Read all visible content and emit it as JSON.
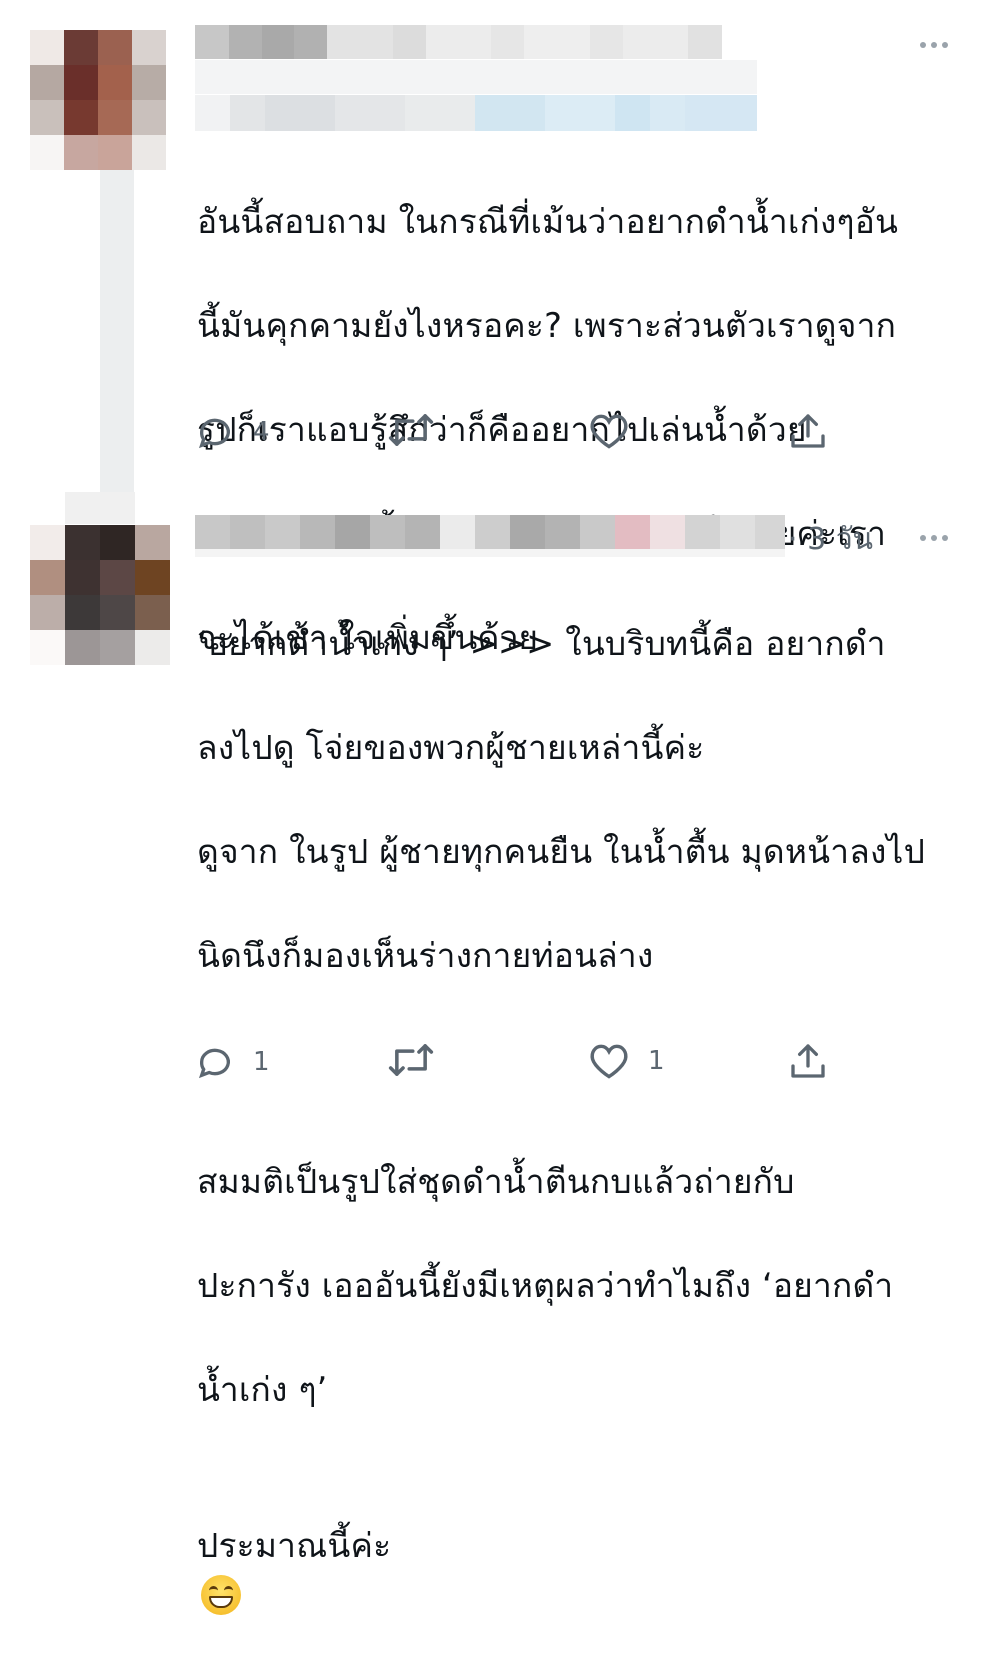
{
  "tweet1": {
    "text_lines": [
      "อันนี้สอบถาม ในกรณีที่เม้นว่าอยากดำน้ำเก่งๆอัน",
      "นี้มันคุกคามยังไงหรอคะ? เพราะส่วนตัวเราดูจาก",
      "รูปก็เราแอบรู้สึกว่าก็คืออยากไปเล่นน้ำด้วย",
      "มากกว่า อันนี้ถามจิงๆนะคะ อธิบายได้เลยค่ะเรา",
      "จะได้เข้า ใจเพิ่มขึ้นด้วย"
    ],
    "actions": {
      "reply_count": "4",
      "retweet_count": "",
      "like_count": ""
    }
  },
  "tweet2": {
    "time_label": "· 3 วัน",
    "text_lines": [
      "‘อยากดำน้ำเก่ง ๆ’ >>> ในบริบทนี้คือ อยากดำ",
      "ลงไปดู โจ่ยของพวกผู้ชายเหล่านี้ค่ะ",
      "ดูจาก ในรูป ผู้ชายทุกคนยืน ในน้ำตื้น มุดหน้าลงไป",
      "นิดนึงก็มองเห็นร่างกายท่อนล่าง",
      "",
      "สมมติเป็นรูปใส่ชุดดำน้ำตีนกบแล้วถ่ายกับ",
      "ปะการัง เอออันนี้ยังมีเหตุผลว่าทำไมถึง ‘อยากดำ",
      "น้ำเก่ง ๆ’",
      "ประมาณนี้ค่ะ"
    ],
    "emoji": "grinning-face-icon",
    "actions": {
      "reply_count": "1",
      "retweet_count": "",
      "like_count": "1"
    }
  },
  "colors": {
    "text": "#0f1419",
    "secondary": "#5b6670",
    "divider": "#eceeef"
  }
}
